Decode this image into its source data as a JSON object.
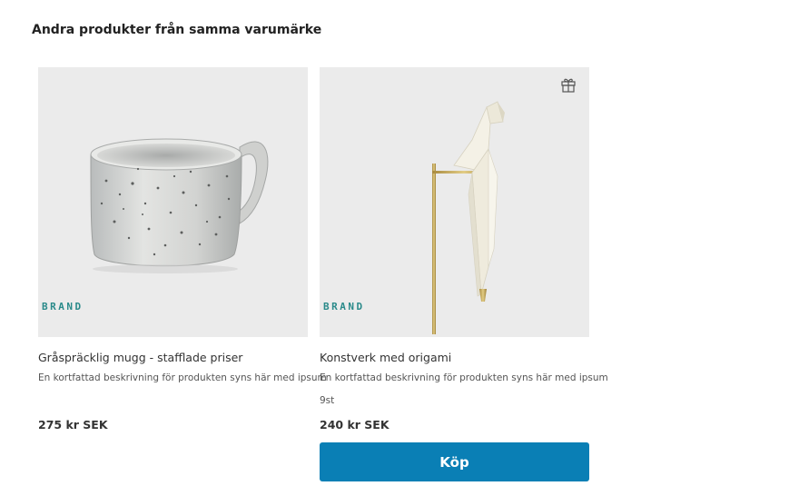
{
  "section": {
    "title": "Andra produkter från samma varumärke"
  },
  "products": [
    {
      "brand": "BRAND",
      "name": "Gråspräcklig mugg - stafflade priser",
      "description": "En kortfattad beskrivning för produkten syns här med ipsum",
      "price": "275 kr SEK",
      "image": "speckled-mug"
    },
    {
      "brand": "BRAND",
      "name": "Konstverk med origami",
      "description": "En kortfattad beskrivning för produkten syns här med ipsum",
      "stock": "9st",
      "price": "240 kr SEK",
      "buy_label": "Köp",
      "image": "origami-bird-lamp",
      "gift_icon": "gift-icon"
    }
  ],
  "colors": {
    "accent": "#0a7fb5",
    "brand": "#2a8a8a",
    "image_bg": "#ebebeb"
  }
}
